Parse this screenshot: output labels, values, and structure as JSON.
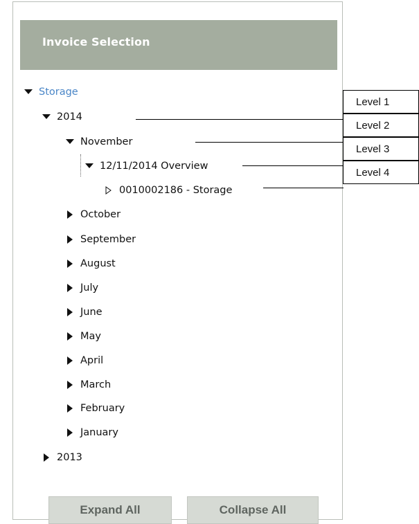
{
  "header": {
    "title": "Invoice Selection"
  },
  "tree": {
    "root": "Storage",
    "year_2014": "2014",
    "month_november": "November",
    "overview": "12/11/2014 Overview",
    "invoice": "0010002186 - Storage",
    "months": [
      "October",
      "September",
      "August",
      "July",
      "June",
      "May",
      "April",
      "March",
      "February",
      "January"
    ],
    "year_2013": "2013"
  },
  "buttons": {
    "expand_all": "Expand All",
    "collapse_all": "Collapse All"
  },
  "levels": [
    "Level 1",
    "Level 2",
    "Level 3",
    "Level 4"
  ],
  "colors": {
    "header_bg": "#a4ad9f",
    "link": "#4a86c7",
    "button_bg": "#d6dad4"
  }
}
